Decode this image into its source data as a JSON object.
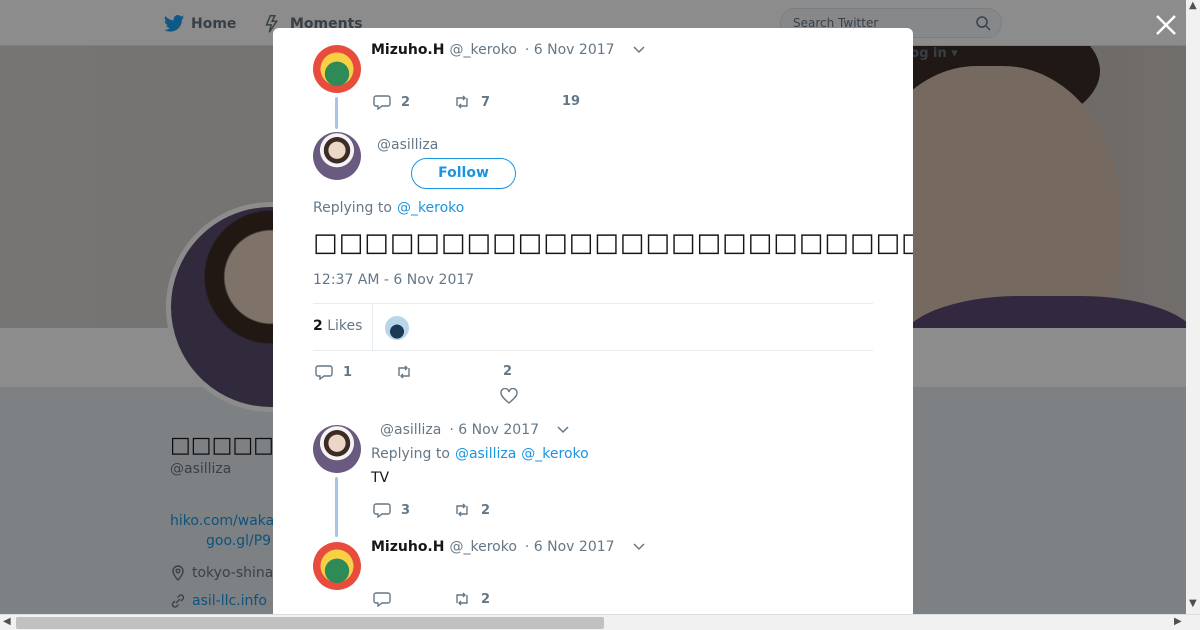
{
  "topbar": {
    "home_label": "Home",
    "moments_label": "Moments",
    "search_placeholder": "Search Twitter",
    "login_label": "Log in"
  },
  "profile": {
    "name": "□□□□□",
    "handle": "@asilliza",
    "link_line1": "hiko.com/waka",
    "link_line2": "goo.gl/P9",
    "location": "tokyo-shina",
    "website": "asil-llc.info"
  },
  "modal": {
    "tweet1": {
      "name": "Mizuho.H",
      "handle": "@_keroko",
      "time": "· 6 Nov 2017",
      "replies": "2",
      "retweets": "7",
      "likes": "19"
    },
    "main": {
      "handle": "@asilliza",
      "follow_label": "Follow",
      "replying_prefix": "Replying to",
      "replying_to": "@_keroko",
      "text": "□□□□□□□□□□□□□□□□□□□□□□□□□□□□□□□□□□□□□□□□□□□□□□□□□□□□□□□□□□□□□□□□",
      "timestamp": "12:37 AM - 6 Nov 2017",
      "likes_count": "2",
      "likes_label": "Likes",
      "replies": "1",
      "likes": "2"
    },
    "reply1": {
      "handle": "@asilliza",
      "time": "· 6 Nov 2017",
      "replying_prefix": "Replying to",
      "replying_to_a": "@asilliza",
      "replying_to_b": "@_keroko",
      "text": "TV",
      "replies": "3",
      "retweets": "2"
    },
    "reply2": {
      "name": "Mizuho.H",
      "handle": "@_keroko",
      "time": "· 6 Nov 2017",
      "retweets": "2"
    }
  },
  "colors": {
    "accent": "#1b95e0",
    "thread_line": "#a8c4e8",
    "muted": "#657786"
  }
}
